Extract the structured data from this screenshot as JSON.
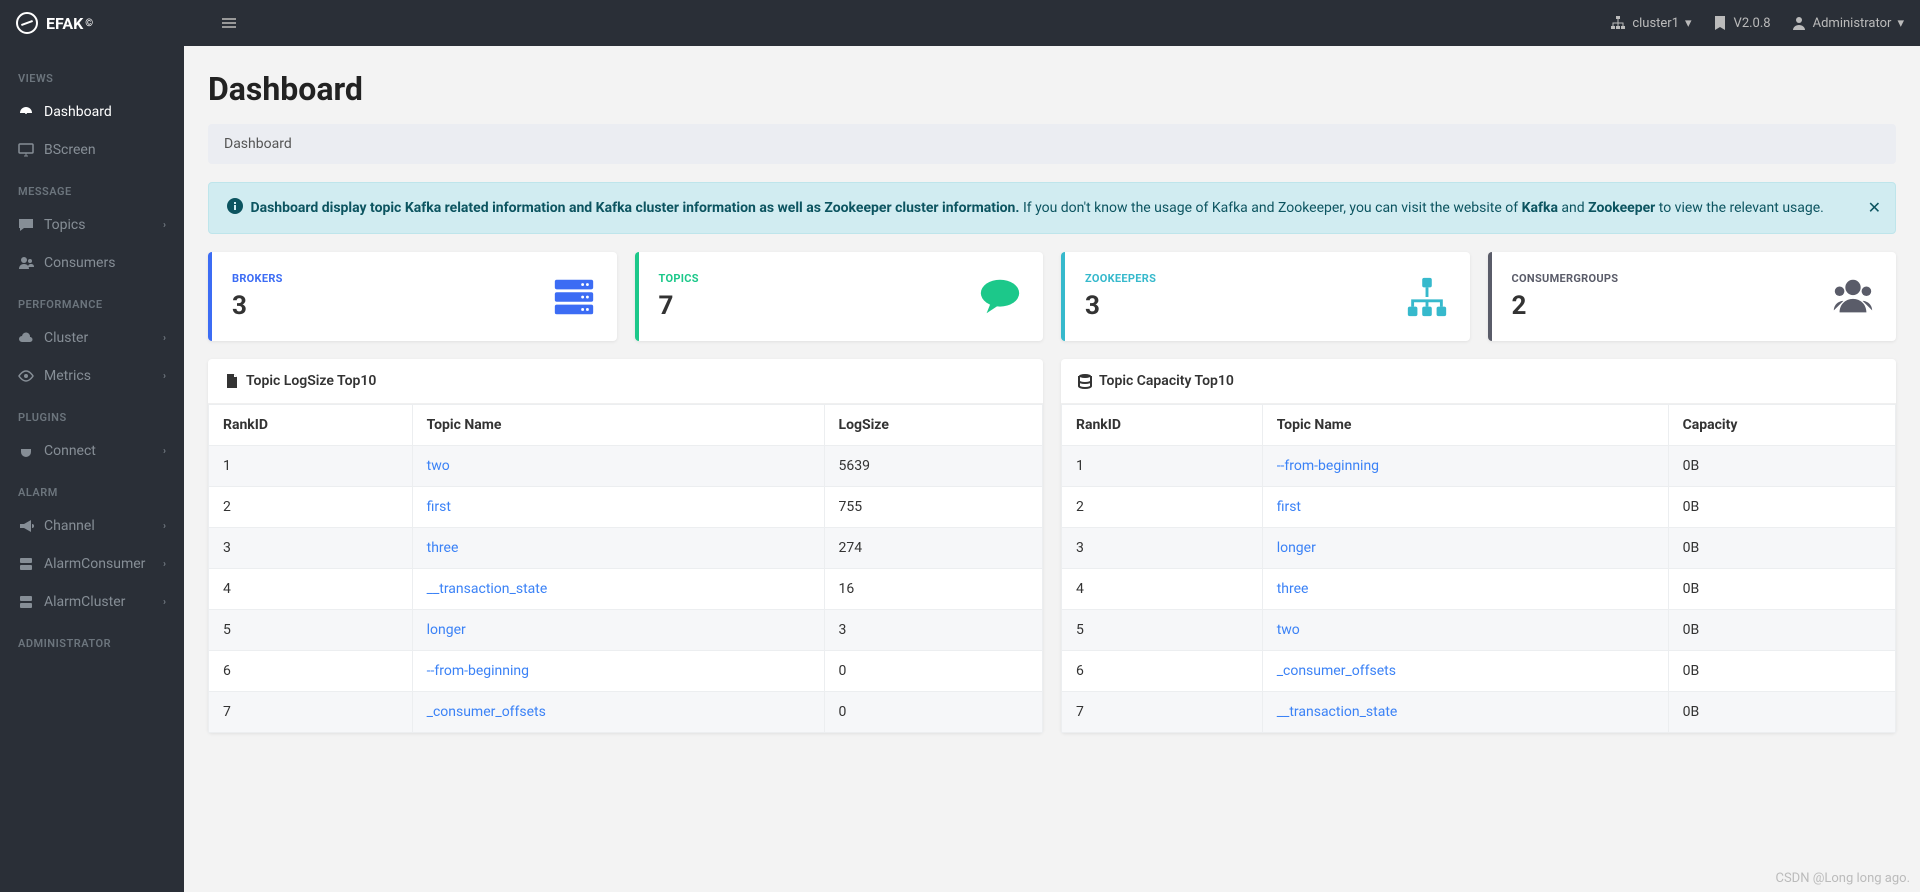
{
  "brand": {
    "name": "EFAK",
    "sup": "©"
  },
  "topbar": {
    "cluster": "cluster1",
    "version": "V2.0.8",
    "user": "Administrator"
  },
  "sidebar": {
    "sections": [
      {
        "title": "VIEWS",
        "items": [
          {
            "key": "dashboard",
            "label": "Dashboard",
            "icon": "dashboard-icon",
            "active": true
          },
          {
            "key": "bscreen",
            "label": "BScreen",
            "icon": "screen-icon"
          }
        ]
      },
      {
        "title": "MESSAGE",
        "items": [
          {
            "key": "topics",
            "label": "Topics",
            "icon": "comment-icon",
            "chevron": true
          },
          {
            "key": "consumers",
            "label": "Consumers",
            "icon": "users-icon"
          }
        ]
      },
      {
        "title": "PERFORMANCE",
        "items": [
          {
            "key": "cluster",
            "label": "Cluster",
            "icon": "cloud-icon",
            "chevron": true
          },
          {
            "key": "metrics",
            "label": "Metrics",
            "icon": "eye-icon",
            "chevron": true
          }
        ]
      },
      {
        "title": "PLUGINS",
        "items": [
          {
            "key": "connect",
            "label": "Connect",
            "icon": "plug-icon",
            "chevron": true
          }
        ]
      },
      {
        "title": "ALARM",
        "items": [
          {
            "key": "channel",
            "label": "Channel",
            "icon": "bullhorn-icon",
            "chevron": true
          },
          {
            "key": "alarmconsumer",
            "label": "AlarmConsumer",
            "icon": "server-icon",
            "chevron": true
          },
          {
            "key": "alarmcluster",
            "label": "AlarmCluster",
            "icon": "server-icon",
            "chevron": true
          }
        ]
      },
      {
        "title": "ADMINISTRATOR",
        "items": []
      }
    ]
  },
  "page": {
    "title": "Dashboard",
    "breadcrumb": "Dashboard"
  },
  "alert": {
    "lead": "Dashboard display topic Kafka related information and Kafka cluster information as well as Zookeeper cluster information.",
    "tail1": " If you don't know the usage of Kafka and Zookeeper, you can visit the website of ",
    "kafka": "Kafka",
    "and": " and ",
    "zk": "Zookeeper",
    "tail2": " to view the relevant usage."
  },
  "stats": {
    "brokers": {
      "label": "BROKERS",
      "value": "3"
    },
    "topics": {
      "label": "TOPICS",
      "value": "7"
    },
    "zookeepers": {
      "label": "ZOOKEEPERS",
      "value": "3"
    },
    "consumergroups": {
      "label": "CONSUMERGROUPS",
      "value": "2"
    }
  },
  "logsize": {
    "title": "Topic LogSize Top10",
    "headers": {
      "rank": "RankID",
      "name": "Topic Name",
      "value": "LogSize"
    },
    "rows": [
      {
        "rank": "1",
        "name": "two",
        "value": "5639"
      },
      {
        "rank": "2",
        "name": "first",
        "value": "755"
      },
      {
        "rank": "3",
        "name": "three",
        "value": "274"
      },
      {
        "rank": "4",
        "name": "__transaction_state",
        "value": "16"
      },
      {
        "rank": "5",
        "name": "longer",
        "value": "3"
      },
      {
        "rank": "6",
        "name": "--from-beginning",
        "value": "0"
      },
      {
        "rank": "7",
        "name": "_consumer_offsets",
        "value": "0"
      }
    ]
  },
  "capacity": {
    "title": "Topic Capacity Top10",
    "headers": {
      "rank": "RankID",
      "name": "Topic Name",
      "value": "Capacity"
    },
    "rows": [
      {
        "rank": "1",
        "name": "--from-beginning",
        "value": "0B"
      },
      {
        "rank": "2",
        "name": "first",
        "value": "0B"
      },
      {
        "rank": "3",
        "name": "longer",
        "value": "0B"
      },
      {
        "rank": "4",
        "name": "three",
        "value": "0B"
      },
      {
        "rank": "5",
        "name": "two",
        "value": "0B"
      },
      {
        "rank": "6",
        "name": "_consumer_offsets",
        "value": "0B"
      },
      {
        "rank": "7",
        "name": "__transaction_state",
        "value": "0B"
      }
    ]
  },
  "watermark": "CSDN @Long long ago."
}
